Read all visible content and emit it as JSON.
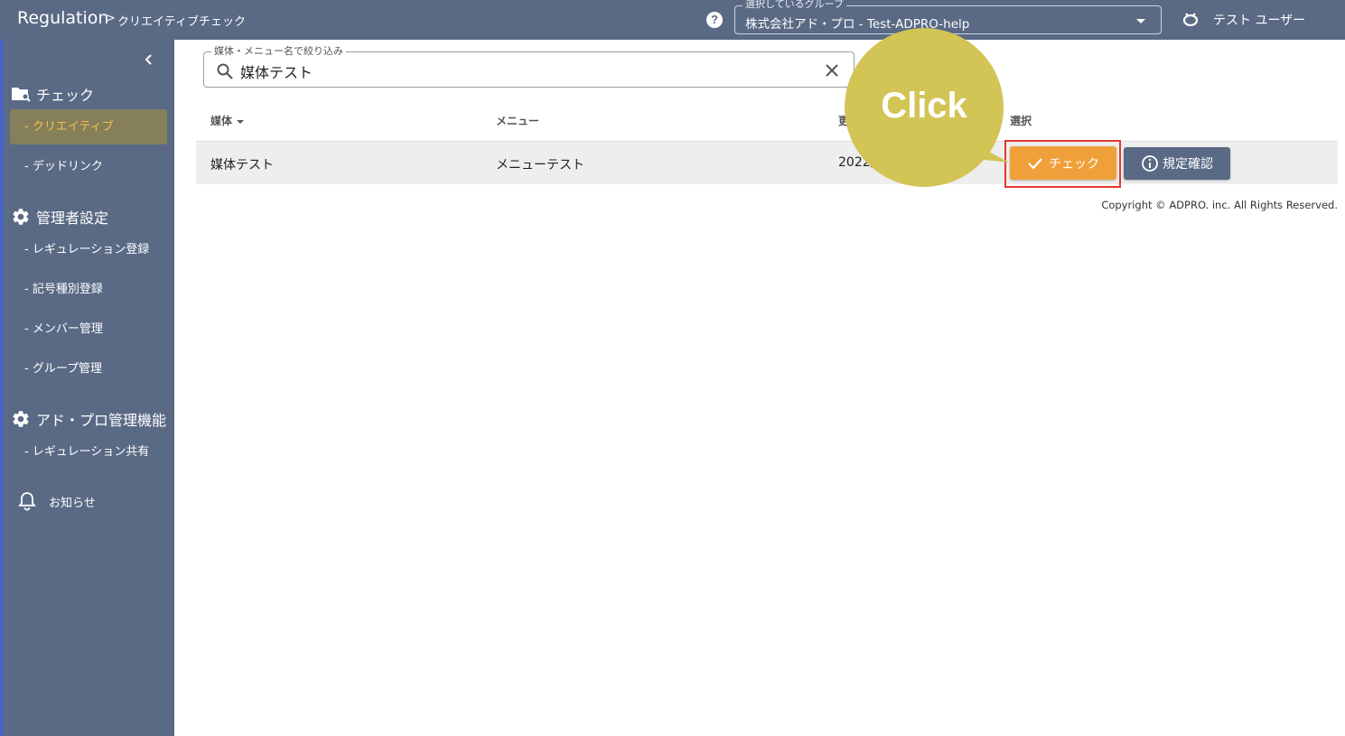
{
  "header": {
    "app_title": "Regulation",
    "crumb_sep": ">",
    "crumb": "クリエイティブチェック",
    "help": "?",
    "group_label": "選択しているグループ",
    "group_value": "株式会社アド・プロ - Test-ADPRO-help",
    "user_name": "テスト ユーザー"
  },
  "sidebar": {
    "sections": [
      {
        "title": "チェック",
        "icon": "folder-search-icon"
      },
      {
        "title": "管理者設定",
        "icon": "gear-icon"
      },
      {
        "title": "アド・プロ管理機能",
        "icon": "gear-icon"
      }
    ],
    "items": [
      {
        "label": "- クリエイティブ",
        "active": true
      },
      {
        "label": "- デッドリンク"
      },
      {
        "label": "- レギュレーション登録"
      },
      {
        "label": "- 記号種別登録"
      },
      {
        "label": "- メンバー管理"
      },
      {
        "label": "- グループ管理"
      },
      {
        "label": "- レギュレーション共有"
      }
    ],
    "notice": "お知らせ"
  },
  "filter": {
    "label": "媒体・メニュー名で絞り込み",
    "value": "媒体テスト"
  },
  "table": {
    "headers": [
      "媒体",
      "メニュー",
      "更",
      "選択"
    ],
    "rows": [
      {
        "media": "媒体テスト",
        "menu": "メニューテスト",
        "updated": "2022/"
      }
    ],
    "check_label": "チェック",
    "rule_label": "規定確認"
  },
  "callout": "Click",
  "copyright": "Copyright © ADPRO. inc. All Rights Reserved.",
  "colors": {
    "header": "#5a6a85",
    "accent_orange": "#f0a03a",
    "active_text": "#f5c24b",
    "callout": "#d3c456",
    "highlight_border": "#e53a2b"
  }
}
